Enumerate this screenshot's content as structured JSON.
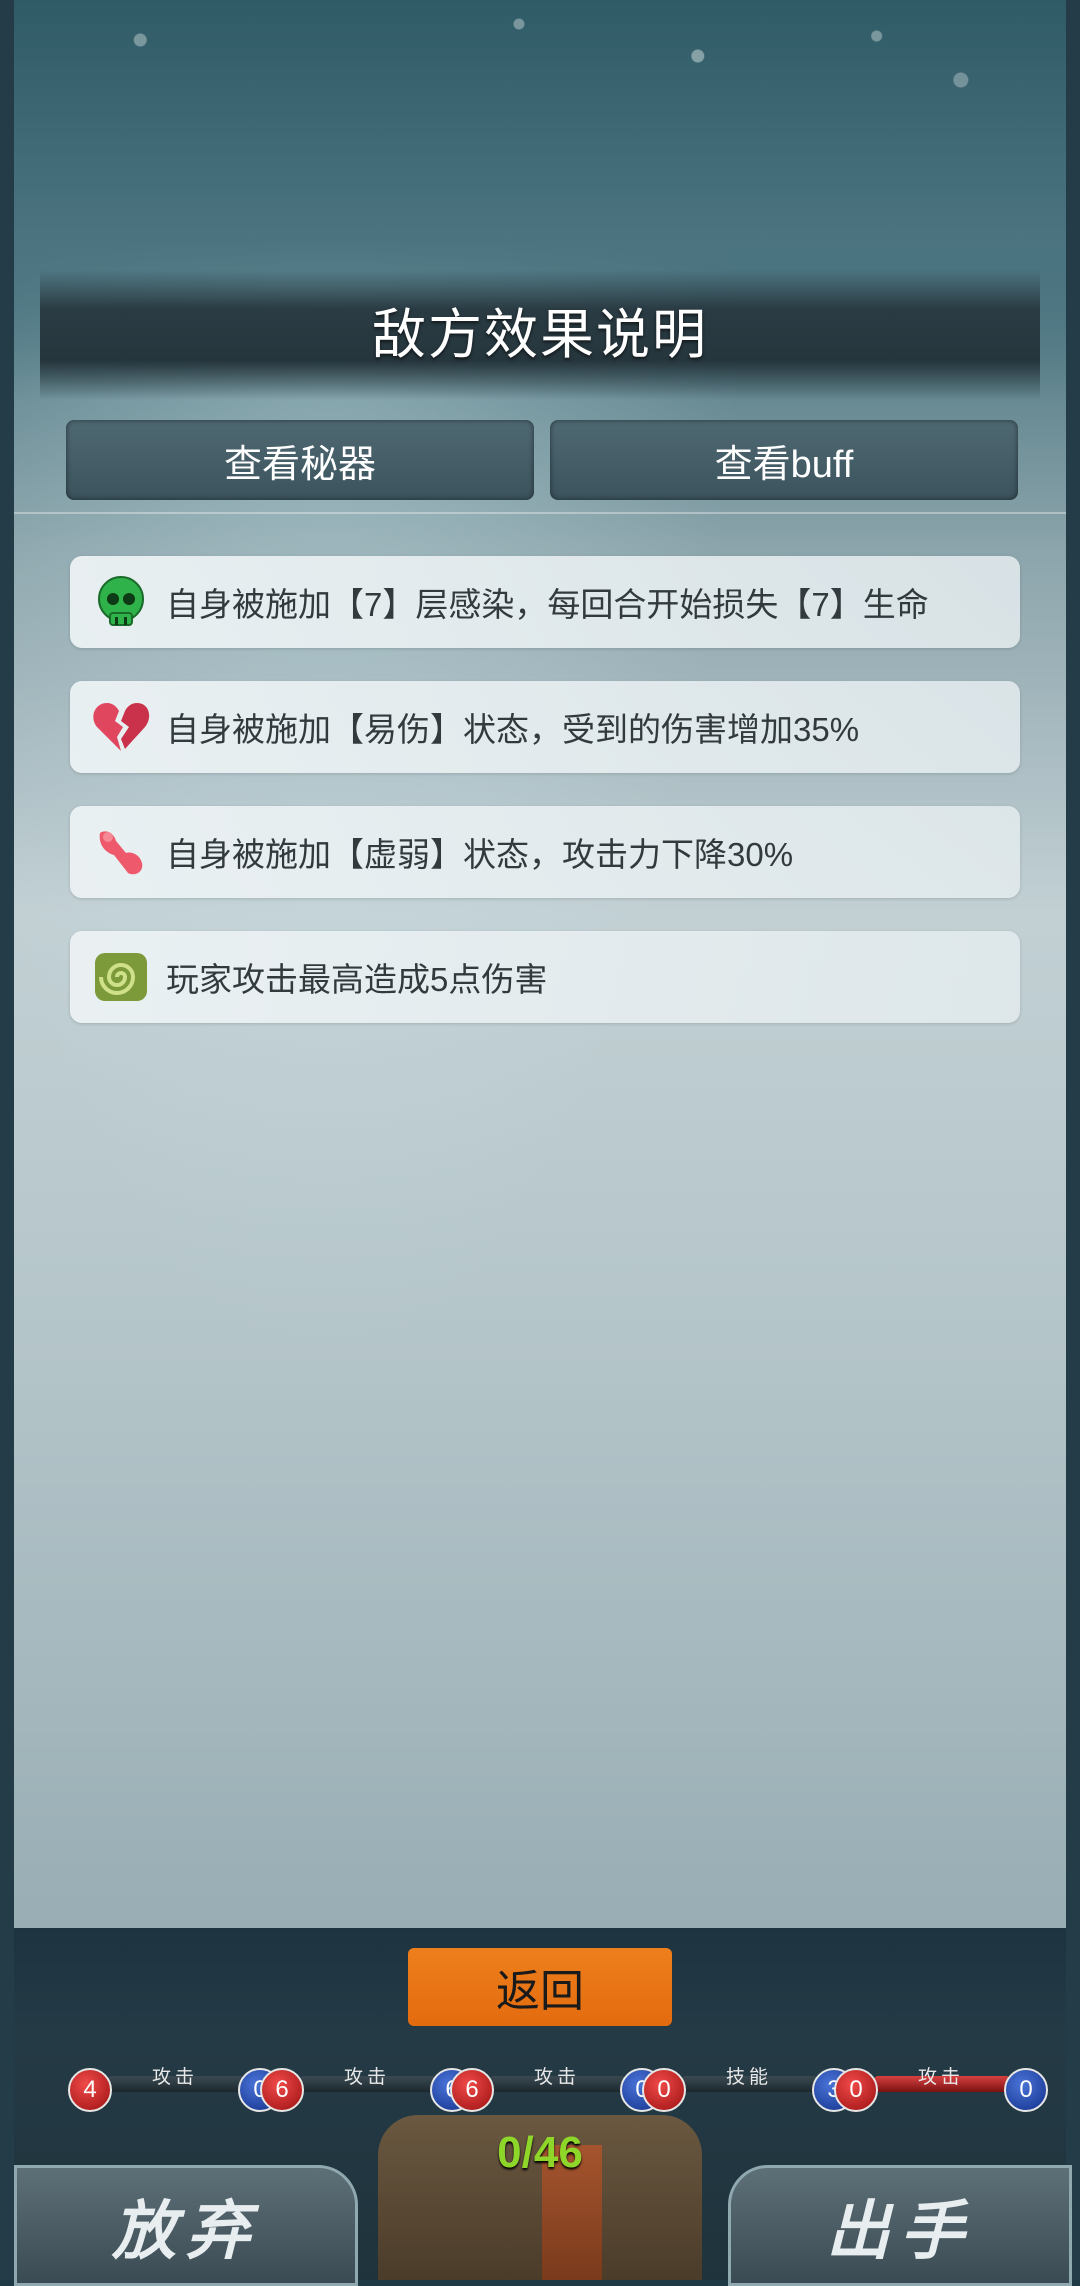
{
  "header": {
    "title": "敌方效果说明"
  },
  "tabs": [
    {
      "label": "查看秘器"
    },
    {
      "label": "查看buff"
    }
  ],
  "effects": [
    {
      "icon": "skull-icon",
      "text": "自身被施加【7】层感染，每回合开始损失【7】生命"
    },
    {
      "icon": "broken-heart-icon",
      "text": "自身被施加【易伤】状态，受到的伤害增加35%"
    },
    {
      "icon": "weak-arm-icon",
      "text": "自身被施加【虚弱】状态，攻击力下降30%"
    },
    {
      "icon": "spiral-icon",
      "text": "玩家攻击最高造成5点伤害"
    }
  ],
  "return_label": "返回",
  "card_slots": [
    {
      "left": "4",
      "label": "攻击",
      "right": "0"
    },
    {
      "left": "6",
      "label": "攻击",
      "right": "6"
    },
    {
      "left": "6",
      "label": "攻击",
      "right": "0"
    },
    {
      "left": "0",
      "label": "技能",
      "right": "3"
    },
    {
      "left": "0",
      "label": "攻击",
      "right": "0"
    }
  ],
  "deck_counter": "0/46",
  "abandon_label": "放弃",
  "play_label": "出手",
  "colors": {
    "accent": "#e36b0f",
    "counter": "#8ed62a"
  }
}
